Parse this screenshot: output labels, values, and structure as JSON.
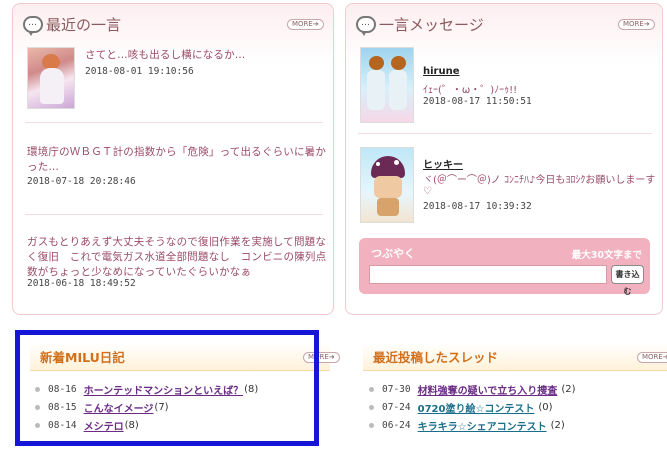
{
  "recent": {
    "title": "最近の一言",
    "more": "MORE",
    "items": [
      {
        "text": "さてと…咳も出るし横になるか…",
        "date": "2018-08-01 19:10:56"
      },
      {
        "text": "環境庁のＷＢＧＴ計の指数から「危険」って出るぐらいに暑かった…",
        "date": "2018-07-18 20:28:46"
      },
      {
        "text": "ガスもとりあえず大丈夫そうなので復旧作業を実施して問題なく復旧　これで電気ガス水道全部問題なし　コンビニの陳列点数がちょっと少なめになっていたぐらいかなぁ",
        "date": "2018-06-18 18:49:52"
      }
    ]
  },
  "messages": {
    "title": "一言メッセージ",
    "more": "MORE",
    "items": [
      {
        "name": "hirune",
        "text": "ｲｪｰ(゜・ω・゜)ﾉｰｩ!!",
        "date": "2018-08-17 11:50:51"
      },
      {
        "name": "ヒッキー",
        "text": "ヾ(＠⌒ー⌒＠)ノ ｺﾝﾆﾁﾊ♪今日もﾖﾛｼｸお願いしまーす♡",
        "date": "2018-08-17 10:39:32"
      }
    ],
    "tsubuyaku": {
      "label": "つぶやく",
      "max": "最大30文字まで",
      "button": "書き込む",
      "placeholder": ""
    }
  },
  "diary": {
    "title": "新着MILU日記",
    "more": "MORE",
    "items": [
      {
        "date": "08-16",
        "title": "ホーンテッドマンションといえば？",
        "count": "(8)"
      },
      {
        "date": "08-15",
        "title": "こんなイメージ",
        "count": "(7)"
      },
      {
        "date": "08-14",
        "title": "メシテロ",
        "count": "(8)"
      }
    ]
  },
  "threads": {
    "title": "最近投稿したスレッド",
    "more": "MORE",
    "items": [
      {
        "date": "07-30",
        "title": "材料強奪の疑いで立ち入り捜査",
        "count": "(2)"
      },
      {
        "date": "07-24",
        "title": "0720塗り絵☆コンテスト",
        "count": "(0)"
      },
      {
        "date": "06-24",
        "title": "キラキラ☆シェアコンテスト",
        "count": "(2)"
      }
    ]
  },
  "colors": {
    "accent_pink": "#f2b1bf",
    "section_orange": "#d26f1b",
    "highlight_box": "#1616d9"
  }
}
